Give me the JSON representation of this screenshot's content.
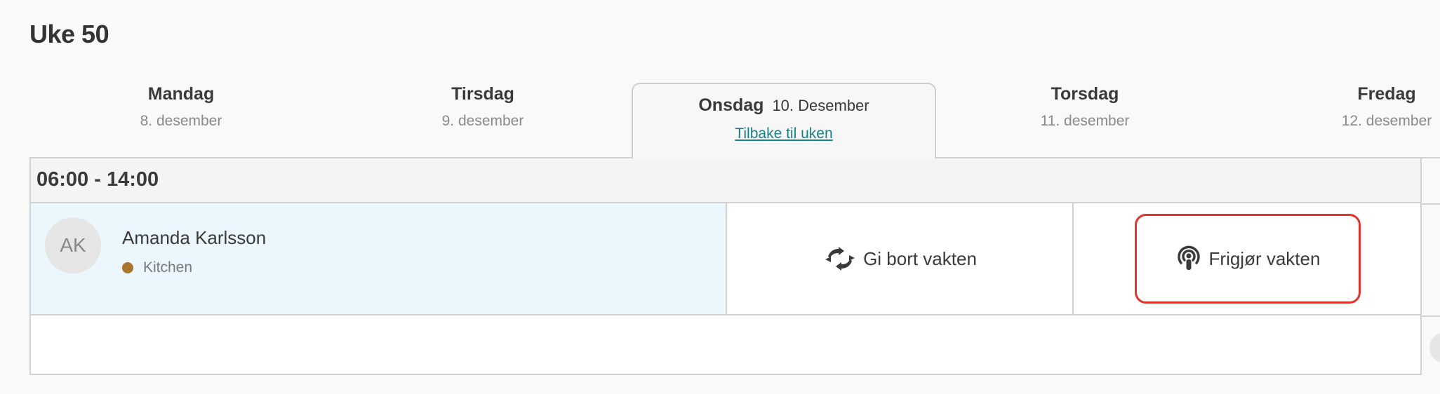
{
  "page": {
    "title": "Uke 50"
  },
  "days": [
    {
      "name": "Mandag",
      "date": "8. desember"
    },
    {
      "name": "Tirsdag",
      "date": "9. desember"
    },
    {
      "name": "Onsdag",
      "date": "10. Desember",
      "back_link": "Tilbake til uken"
    },
    {
      "name": "Torsdag",
      "date": "11. desember"
    },
    {
      "name": "Fredag",
      "date": "12. desember"
    }
  ],
  "shift": {
    "time": "06:00 - 14:00",
    "employee": {
      "initials": "AK",
      "name": "Amanda Karlsson",
      "department": "Kitchen",
      "department_color": "#a8752a"
    },
    "actions": {
      "give_away": "Gi bort vakten",
      "release": "Frigjør vakten"
    }
  },
  "colors": {
    "highlight_border": "#e0342a",
    "link": "#1a7f86",
    "row_bg": "#ecf6fd"
  },
  "icons": {
    "give_away": "swap-arrows-icon",
    "release": "broadcast-icon"
  }
}
